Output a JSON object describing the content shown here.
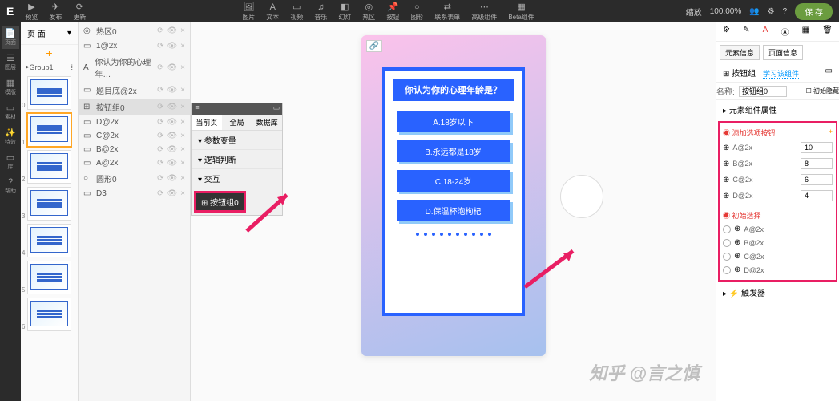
{
  "topbar": {
    "left": [
      {
        "icon": "▶",
        "label": "预览"
      },
      {
        "icon": "✈",
        "label": "发布"
      },
      {
        "icon": "⟳",
        "label": "更新"
      }
    ],
    "center": [
      {
        "icon": "🖼",
        "label": "图片"
      },
      {
        "icon": "A",
        "label": "文本"
      },
      {
        "icon": "▭",
        "label": "视频"
      },
      {
        "icon": "♫",
        "label": "音乐"
      },
      {
        "icon": "◧",
        "label": "幻灯"
      },
      {
        "icon": "◎",
        "label": "热区"
      },
      {
        "icon": "📌",
        "label": "按钮"
      },
      {
        "icon": "○",
        "label": "图形"
      },
      {
        "icon": "⇄",
        "label": "联系表单"
      },
      {
        "icon": "⋯",
        "label": "高级组件"
      },
      {
        "icon": "▦",
        "label": "Beta组件"
      }
    ],
    "zoom_label": "缩放",
    "zoom_value": "100.00%",
    "save": "保 存"
  },
  "sidebar": [
    {
      "icon": "📄",
      "label": "页面",
      "active": true
    },
    {
      "icon": "☰",
      "label": "图层"
    },
    {
      "icon": "▦",
      "label": "模版"
    },
    {
      "icon": "▭",
      "label": "素材"
    },
    {
      "icon": "✨",
      "label": "特效"
    },
    {
      "icon": "▭",
      "label": "库"
    },
    {
      "icon": "?",
      "label": "帮助"
    }
  ],
  "thumbs": {
    "header": "页 面",
    "group": "Group1",
    "count": 6
  },
  "layers": [
    {
      "icon": "◎",
      "name": "热区0"
    },
    {
      "icon": "▭",
      "name": "1@2x"
    },
    {
      "icon": "A",
      "name": "你认为你的心理年…"
    },
    {
      "icon": "▭",
      "name": "题目底@2x"
    },
    {
      "icon": "⊞",
      "name": "按钮组0",
      "sel": true
    },
    {
      "icon": "▭",
      "name": "D@2x"
    },
    {
      "icon": "▭",
      "name": "C@2x"
    },
    {
      "icon": "▭",
      "name": "B@2x"
    },
    {
      "icon": "▭",
      "name": "A@2x"
    },
    {
      "icon": "○",
      "name": "圆形0"
    },
    {
      "icon": "▭",
      "name": "D3"
    }
  ],
  "float": {
    "tabs": [
      "当前页",
      "全局",
      "数据库"
    ],
    "rows": [
      "参数变量",
      "逻辑判断",
      "交互"
    ],
    "tag": "⊞ 按钮组0"
  },
  "phone": {
    "title": "你认为你的心理年龄是？",
    "opts": [
      "A.18岁以下",
      "B.永远都是18岁",
      "C.18-24岁",
      "D.保温杯泡枸杞"
    ]
  },
  "inspector": {
    "tabs": [
      "元素信息",
      "页面信息"
    ],
    "comp_title": "按钮组",
    "link": "学习该组件",
    "name_label": "名称:",
    "name_value": "按钮组0",
    "hide_label": "初始隐藏",
    "section_meta": "元素组件属性",
    "section_add": "添加选项按钮",
    "opts": [
      {
        "label": "A@2x",
        "val": "10"
      },
      {
        "label": "B@2x",
        "val": "8"
      },
      {
        "label": "C@2x",
        "val": "6"
      },
      {
        "label": "D@2x",
        "val": "4"
      }
    ],
    "section_init": "初始选择",
    "init_opts": [
      "A@2x",
      "B@2x",
      "C@2x",
      "D@2x"
    ],
    "section_trigger": "触发器"
  },
  "watermark": "知乎 @言之慎"
}
